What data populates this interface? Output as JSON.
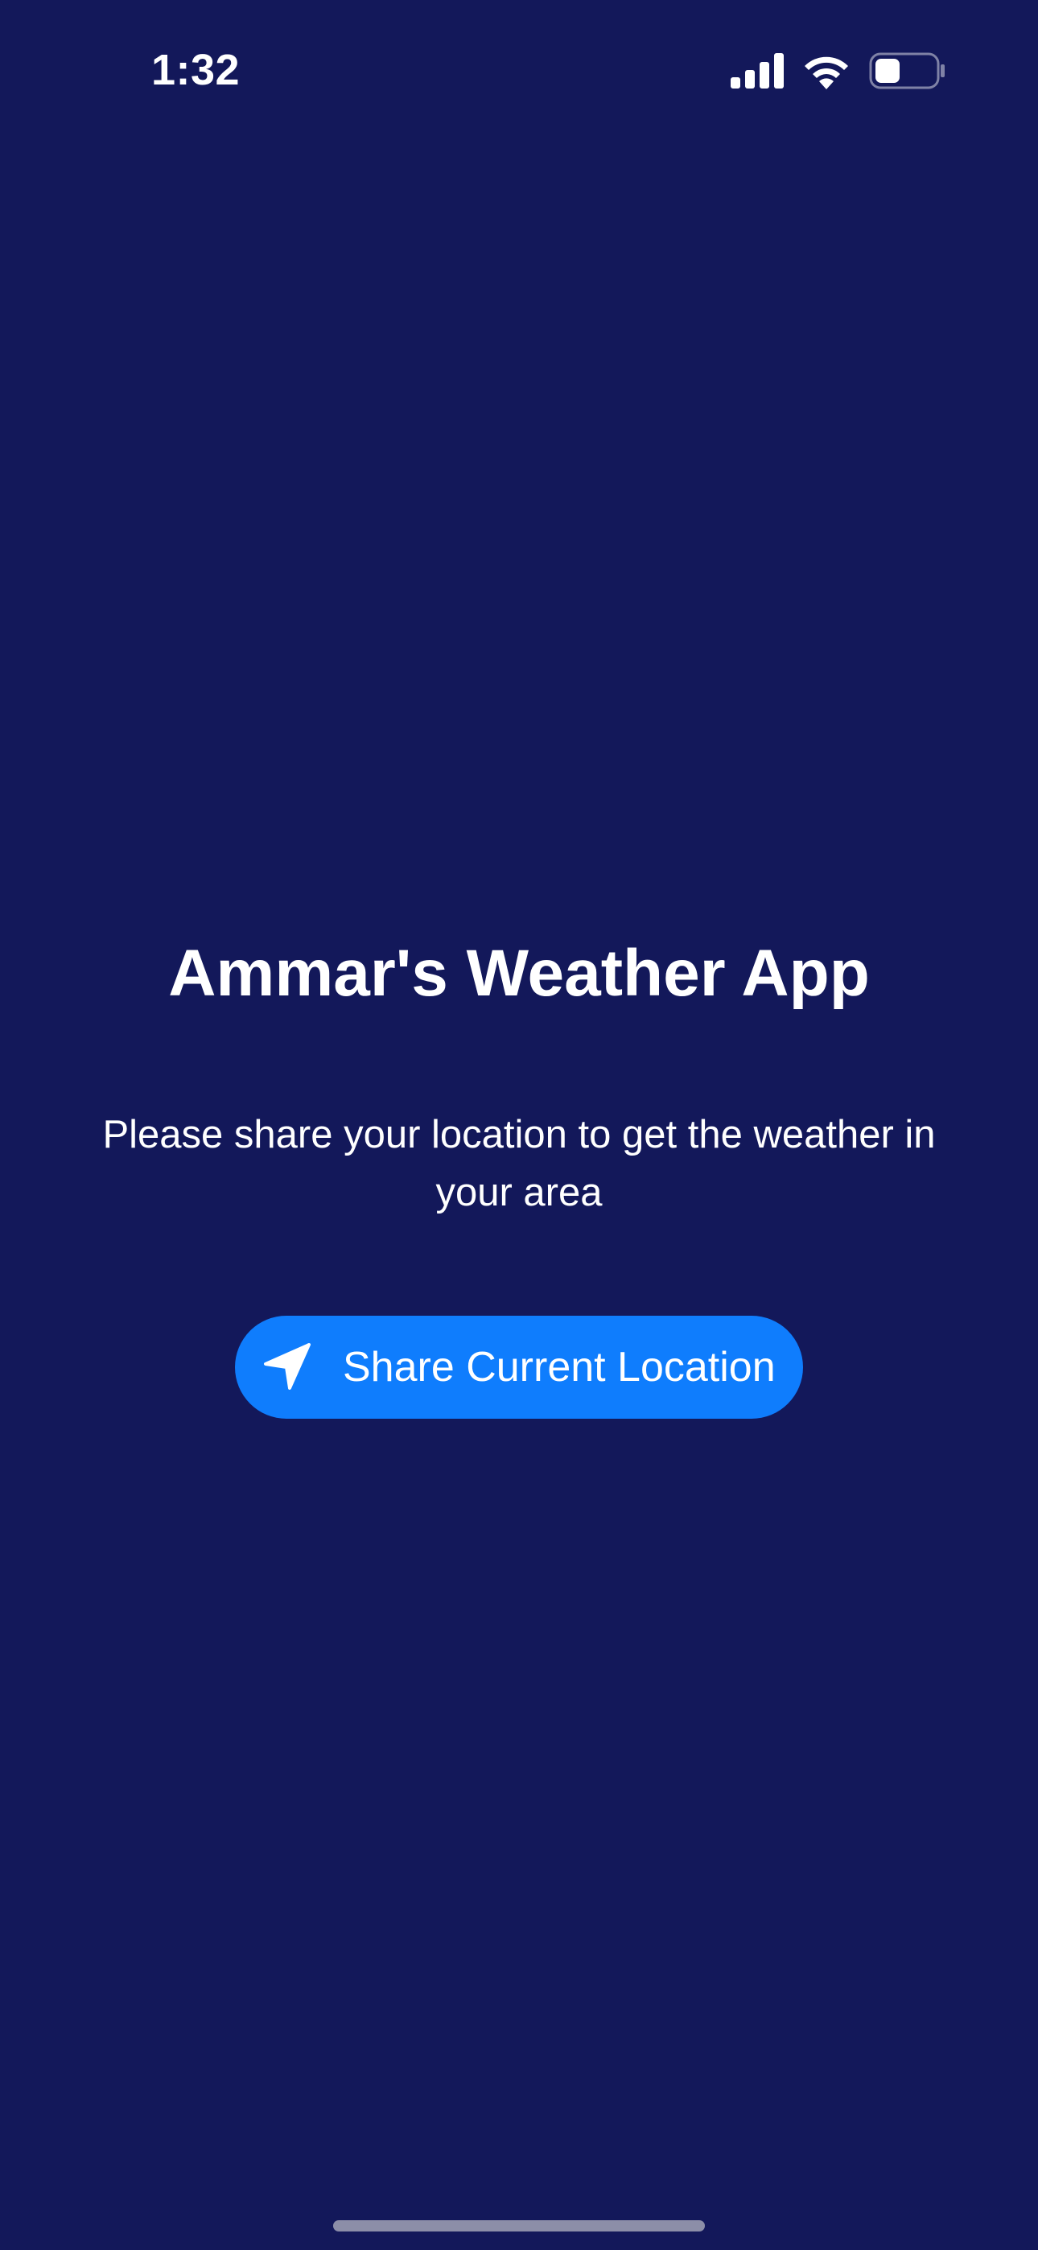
{
  "status_bar": {
    "time": "1:32",
    "icons": [
      "cellular-signal-icon",
      "wifi-icon",
      "battery-icon"
    ]
  },
  "main": {
    "title": "Ammar's Weather App",
    "subtitle": "Please share your location to get the weather in your area",
    "share_button": {
      "label": "Share Current Location",
      "icon": "location-arrow-icon"
    }
  },
  "colors": {
    "background": "#13185a",
    "accent": "#0f7dfd",
    "text": "#ffffff"
  }
}
